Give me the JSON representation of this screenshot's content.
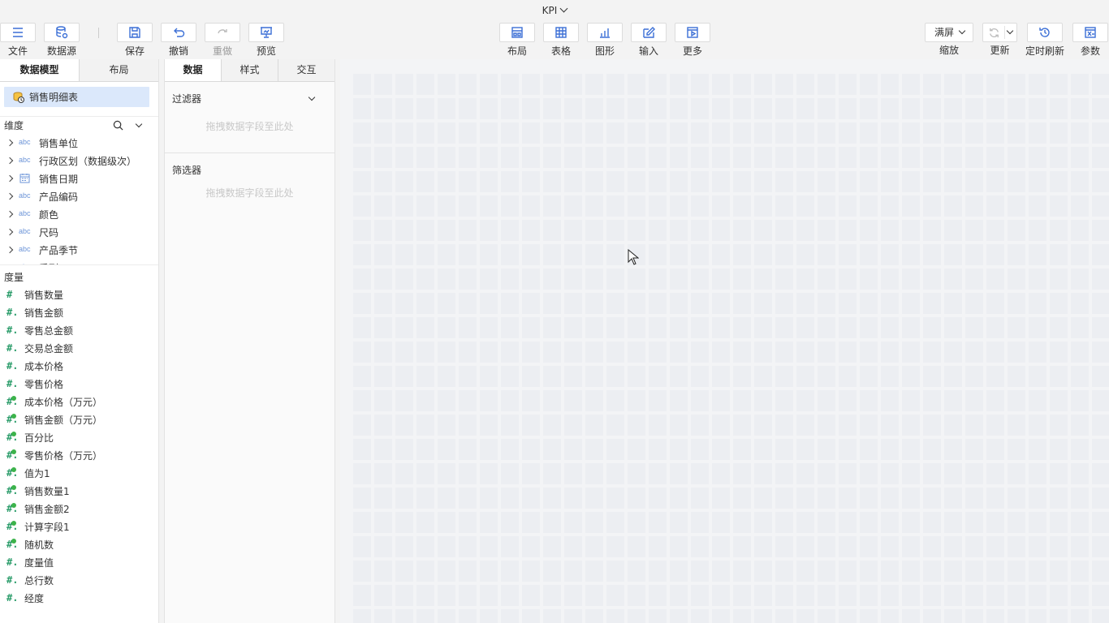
{
  "title": "KPI",
  "toolbar": {
    "file": "文件",
    "datasource": "数据源",
    "save": "保存",
    "undo": "撤销",
    "redo": "重做",
    "preview": "预览",
    "layout": "布局",
    "table": "表格",
    "chart": "图形",
    "input": "输入",
    "more": "更多",
    "zoom_value": "满屏",
    "zoom_label": "缩放",
    "refresh": "更新",
    "scheduled_refresh": "定时刷新",
    "params": "参数"
  },
  "left_panel": {
    "tabs": [
      "数据模型",
      "布局"
    ],
    "active_tab": "数据模型",
    "dataset": "销售明细表",
    "dimensions_title": "维度",
    "dimensions": [
      {
        "label": "销售单位",
        "type": "abc",
        "expandable": true
      },
      {
        "label": "行政区划（数据级次）",
        "type": "abc",
        "expandable": true
      },
      {
        "label": "销售日期",
        "type": "date",
        "expandable": true
      },
      {
        "label": "产品编码",
        "type": "abc",
        "expandable": true
      },
      {
        "label": "颜色",
        "type": "abc",
        "expandable": true
      },
      {
        "label": "尺码",
        "type": "abc",
        "expandable": true
      },
      {
        "label": "产品季节",
        "type": "abc",
        "expandable": true
      },
      {
        "label": "系列",
        "type": "abc",
        "expandable": false
      }
    ],
    "measures_title": "度量",
    "measures": [
      {
        "label": "销售数量",
        "calculated": false
      },
      {
        "label": "销售金额",
        "calculated": false
      },
      {
        "label": "零售总金额",
        "calculated": false
      },
      {
        "label": "交易总金额",
        "calculated": false
      },
      {
        "label": "成本价格",
        "calculated": false
      },
      {
        "label": "零售价格",
        "calculated": false
      },
      {
        "label": "成本价格（万元）",
        "calculated": true
      },
      {
        "label": "销售金额（万元）",
        "calculated": true
      },
      {
        "label": "百分比",
        "calculated": true
      },
      {
        "label": "零售价格（万元）",
        "calculated": true
      },
      {
        "label": "值为1",
        "calculated": true
      },
      {
        "label": "销售数量1",
        "calculated": true
      },
      {
        "label": "销售金额2",
        "calculated": true
      },
      {
        "label": "计算字段1",
        "calculated": true
      },
      {
        "label": "随机数",
        "calculated": true
      },
      {
        "label": "度量值",
        "calculated": false
      },
      {
        "label": "总行数",
        "calculated": false
      },
      {
        "label": "经度",
        "calculated": false
      }
    ]
  },
  "mid_panel": {
    "tabs": [
      "数据",
      "样式",
      "交互"
    ],
    "active_tab": "数据",
    "filter_title": "过滤器",
    "filter_hint": "拖拽数据字段至此处",
    "selector_title": "筛选器",
    "selector_hint": "拖拽数据字段至此处"
  },
  "colors": {
    "accent": "#3b6fd6",
    "selected_bg": "#dbe8fb",
    "measure_icon": "#2f9e6d",
    "calc_dot": "#3cb34a"
  }
}
